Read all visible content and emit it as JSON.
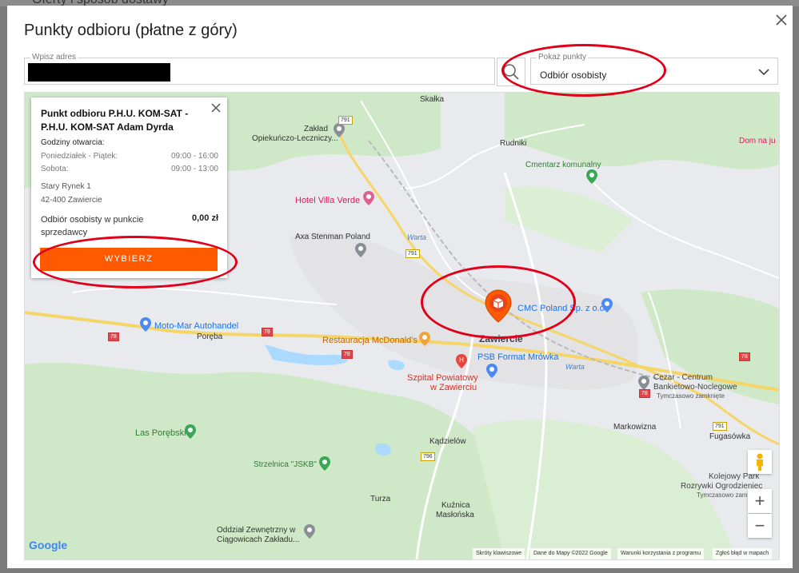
{
  "background": {
    "page_title": "Oferty i sposób dostawy"
  },
  "modal": {
    "title": "Punkty odbioru (płatne z góry)"
  },
  "address": {
    "legend": "Wpisz adres"
  },
  "show_points": {
    "legend": "Pokaż punkty",
    "selected": "Odbiór osobisty"
  },
  "card": {
    "title": "Punkt odbioru P.H.U. KOM-SAT - P.H.U. KOM-SAT Adam Dyrda",
    "hours_label": "Godziny otwarcia:",
    "hours": [
      {
        "day": "Poniedziałek - Piątek:",
        "time": "09:00 - 16:00"
      },
      {
        "day": "Sobota:",
        "time": "09:00 - 13:00"
      }
    ],
    "street": "Stary Rynek 1",
    "city": "42-400 Zawiercie",
    "option": "Odbiór osobisty w punkcie sprzedawcy",
    "price": "0,00 zł",
    "button": "WYBIERZ"
  },
  "map": {
    "labels": {
      "skalka": "Skałka",
      "zaklad": "Zakład",
      "zaklad2": "Opiekuńczo-Leczniczy...",
      "rudniki": "Rudniki",
      "cmentarz": "Cmentarz komunalny",
      "dom": "Dom na ju",
      "villa": "Hotel Villa Verde",
      "axa": "Axa Stenman Poland",
      "motomar": "Moto-Mar Autohandel",
      "poreba": "Poręba",
      "mcd": "Restauracja McDonald's",
      "zawiercie": "Zawiercie",
      "cmc": "CMC Poland Sp. z o.o",
      "psb": "PSB Format Mrówka",
      "szpital1": "Szpital Powiatowy",
      "szpital2": "w Zawierciu",
      "cezar1": "Cezar - Centrum",
      "cezar2": "Bankietowo-Noclegowe",
      "cezar3": "Tymczasowo zamknięte",
      "markowizna": "Markowizna",
      "fugasowka": "Fugasówka",
      "las": "Las Porębski",
      "kadzielow": "Kądzielów",
      "strzelnica": "Strzelnica \"JSKB\"",
      "kolejowy1": "Kolejowy Park",
      "kolejowy2": "Rozrywki Ogrodzieniec",
      "kolejowy3": "Tymczasowo zamknięte",
      "turza": "Turza",
      "kuznica1": "Kuźnica",
      "kuznica2": "Masłońska",
      "oddzial1": "Oddział Zewnętrzny w",
      "oddzial2": "Ciągowicach Zakładu...",
      "warta": "Warta",
      "warta2": "Warta"
    },
    "routes": {
      "r791a": "791",
      "r791b": "791",
      "r791c": "791",
      "r78a": "78",
      "r78b": "78",
      "r78c": "78",
      "r78d": "78",
      "r78e": "78",
      "r796": "796"
    },
    "logo": "Google",
    "attribution": {
      "shortcuts": "Skróty klawiszowe",
      "data": "Dane do Mapy ©2022 Google",
      "terms": "Warunki korzystania z programu",
      "report": "Zgłoś błąd w mapach"
    },
    "zoom_in": "+",
    "zoom_out": "−"
  },
  "colors": {
    "accent": "#ff5a00",
    "highlight": "#e0001a",
    "map_green": "#cfe8c8",
    "map_water": "#aadaff"
  }
}
